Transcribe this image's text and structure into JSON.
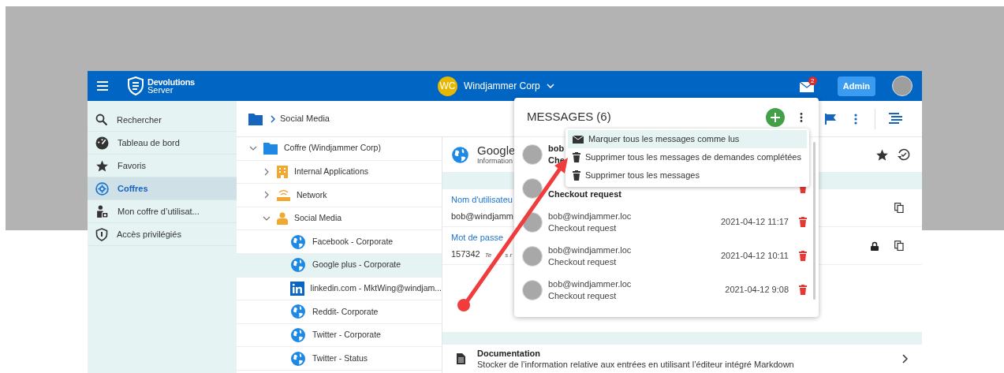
{
  "header": {
    "brand": "Devolutions",
    "product": "Server",
    "org_initials": "WC",
    "org_name": "Windjammer Corp",
    "mail_badge": "2",
    "admin_button": "Admin"
  },
  "sidebar": {
    "items": [
      {
        "label": "Rechercher",
        "kind": "search",
        "selected": false
      },
      {
        "label": "Tableau de bord",
        "kind": "dashboard",
        "selected": false
      },
      {
        "label": "Favoris",
        "kind": "favorites",
        "selected": false
      },
      {
        "label": "Coffres",
        "kind": "vaults",
        "selected": true
      },
      {
        "label": "Mon coffre d’utilisat...",
        "kind": "user",
        "selected": false
      },
      {
        "label": "Accès privilégiés",
        "kind": "privileged",
        "selected": false
      }
    ]
  },
  "breadcrumb": {
    "current": "Social Media"
  },
  "tree": [
    {
      "label": "Coffre (Windjammer Corp)",
      "kind": "folder",
      "expanded": true,
      "selected": false,
      "children": [
        {
          "label": "Internal Applications",
          "kind": "building",
          "expanded": false,
          "selected": false
        },
        {
          "label": "Network",
          "kind": "network",
          "expanded": false,
          "selected": false
        },
        {
          "label": "Social Media",
          "kind": "person",
          "expanded": true,
          "selected": false,
          "children": [
            {
              "label": "Facebook - Corporate",
              "kind": "web",
              "selected": false
            },
            {
              "label": "Google plus - Corporate",
              "kind": "web",
              "selected": true
            },
            {
              "label": "linkedin.com - MktWing@windjam...",
              "kind": "linkedin",
              "selected": false
            },
            {
              "label": "Reddit- Corporate",
              "kind": "web",
              "selected": false
            },
            {
              "label": "Twitter - Corporate",
              "kind": "web",
              "selected": false
            },
            {
              "label": "Twitter - Status",
              "kind": "web",
              "selected": false
            }
          ]
        }
      ]
    }
  ],
  "details": {
    "title": "Google",
    "subtitle": "Information",
    "fields": [
      {
        "label": "Nom d'utilisateu",
        "value": "bob@windjamm",
        "locked": false
      },
      {
        "label": "Mot de passe",
        "value": "157342",
        "note": "Te",
        "note_2": "s r",
        "locked": true
      }
    ],
    "documentation": {
      "title": "Documentation",
      "description": "Stocker de l’information relative aux entrées en utilisant l’éditeur intégré Markdown"
    }
  },
  "messages": {
    "title": "MESSAGES (6)",
    "items": [
      {
        "sender": "bob",
        "subject": "Che",
        "unread": true
      },
      {
        "subject": "Checkout request",
        "unread": true
      },
      {
        "sender": "bob@windjammer.loc",
        "subject": "Checkout request",
        "date": "2021-04-12 11:17",
        "unread": false
      },
      {
        "sender": "bob@windjammer.loc",
        "subject": "Checkout request",
        "date": "2021-04-12 10:11",
        "unread": false
      },
      {
        "sender": "bob@windjammer.loc",
        "subject": "Checkout request",
        "date": "2021-04-12 9:08",
        "unread": false
      }
    ],
    "menu": [
      {
        "label": "Marquer tous les messages comme lus",
        "kind": "mark_read",
        "selected": true
      },
      {
        "label": "Supprimer tous les messages de demandes complétées",
        "kind": "delete",
        "selected": false
      },
      {
        "label": "Supprimer tous les messages",
        "kind": "delete",
        "selected": false
      }
    ]
  }
}
